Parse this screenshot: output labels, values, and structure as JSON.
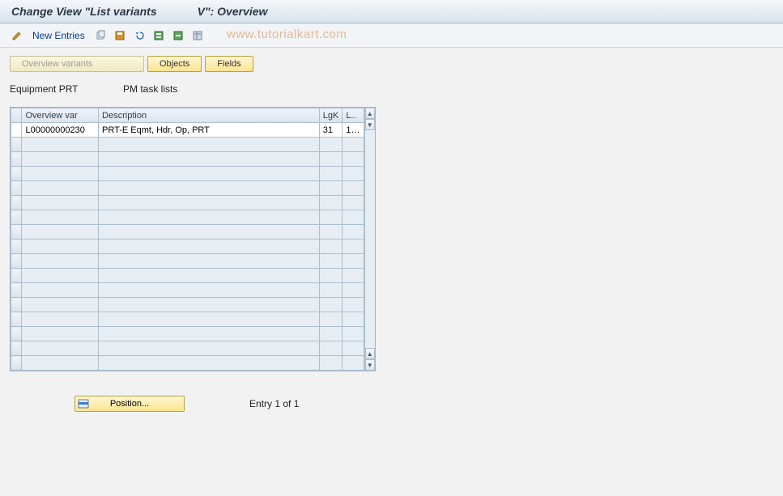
{
  "header": {
    "title_left": "Change View \"List variants",
    "title_right": "V\": Overview"
  },
  "toolbar": {
    "new_entries_label": "New Entries",
    "watermark": "www.tutorialkart.com"
  },
  "tabs": {
    "overview_variants": "Overview variants",
    "objects": "Objects",
    "fields": "Fields"
  },
  "fields": {
    "equipment_prt_label": "Equipment PRT",
    "equipment_prt_value": "",
    "pm_task_lists_label": "PM task lists"
  },
  "table": {
    "columns": {
      "overview_var": "Overview var",
      "description": "Description",
      "lgk": "LgK",
      "l": "L.."
    },
    "rows": [
      {
        "overview_var": "L00000000230",
        "description": "PRT-E Eqmt, Hdr, Op, PRT",
        "lgk": "31",
        "l": "1…"
      }
    ],
    "empty_rows": 16
  },
  "bottom": {
    "position_label": "Position...",
    "entry_text": "Entry 1 of 1"
  },
  "icons": {
    "pencil": "pencil-icon",
    "copy": "copy-icon",
    "save": "save-icon",
    "undo": "undo-icon",
    "select_all": "select-all-icon",
    "deselect_all": "deselect-all-icon",
    "layout": "layout-icon",
    "position": "position-icon"
  }
}
